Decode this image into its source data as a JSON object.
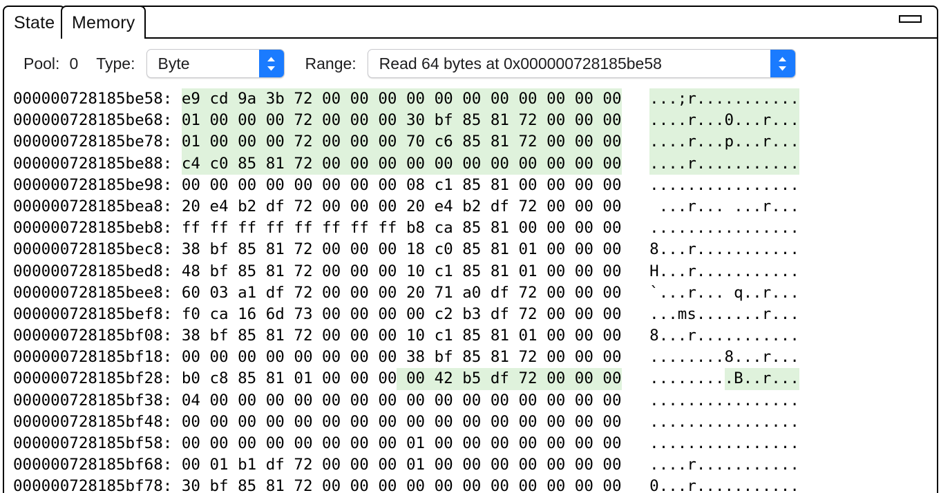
{
  "window": {
    "minimize_icon": "minimize-icon"
  },
  "tabs": [
    {
      "id": "state",
      "label": "State",
      "active": false
    },
    {
      "id": "memory",
      "label": "Memory",
      "active": true
    }
  ],
  "toolbar": {
    "pool_label": "Pool:",
    "pool_value": "0",
    "type_label": "Type:",
    "type_value": "Byte",
    "range_label": "Range:",
    "range_value": "Read 64 bytes at 0x000000728185be58",
    "stepper_icon": "stepper-up-down-icon",
    "accent_color": "#1a7bff"
  },
  "highlight_color": "#dff2dc",
  "hexdump": {
    "bytes_per_row": 16,
    "rows": [
      {
        "address": "000000728185be58",
        "bytes": [
          "e9",
          "cd",
          "9a",
          "3b",
          "72",
          "00",
          "00",
          "00",
          "00",
          "00",
          "00",
          "00",
          "00",
          "00",
          "00",
          "00"
        ],
        "ascii": "...;r...........",
        "hl_bytes": [
          0,
          15
        ],
        "hl_ascii": [
          0,
          15
        ]
      },
      {
        "address": "000000728185be68",
        "bytes": [
          "01",
          "00",
          "00",
          "00",
          "72",
          "00",
          "00",
          "00",
          "30",
          "bf",
          "85",
          "81",
          "72",
          "00",
          "00",
          "00"
        ],
        "ascii": "....r...0...r...",
        "hl_bytes": [
          0,
          15
        ],
        "hl_ascii": [
          0,
          15
        ]
      },
      {
        "address": "000000728185be78",
        "bytes": [
          "01",
          "00",
          "00",
          "00",
          "72",
          "00",
          "00",
          "00",
          "70",
          "c6",
          "85",
          "81",
          "72",
          "00",
          "00",
          "00"
        ],
        "ascii": "....r...p...r...",
        "hl_bytes": [
          0,
          15
        ],
        "hl_ascii": [
          0,
          15
        ]
      },
      {
        "address": "000000728185be88",
        "bytes": [
          "c4",
          "c0",
          "85",
          "81",
          "72",
          "00",
          "00",
          "00",
          "00",
          "00",
          "00",
          "00",
          "00",
          "00",
          "00",
          "00"
        ],
        "ascii": "....r...........",
        "hl_bytes": [
          0,
          15
        ],
        "hl_ascii": [
          0,
          15
        ]
      },
      {
        "address": "000000728185be98",
        "bytes": [
          "00",
          "00",
          "00",
          "00",
          "00",
          "00",
          "00",
          "00",
          "08",
          "c1",
          "85",
          "81",
          "00",
          "00",
          "00",
          "00"
        ],
        "ascii": "................",
        "hl_bytes": null,
        "hl_ascii": null
      },
      {
        "address": "000000728185bea8",
        "bytes": [
          "20",
          "e4",
          "b2",
          "df",
          "72",
          "00",
          "00",
          "00",
          "20",
          "e4",
          "b2",
          "df",
          "72",
          "00",
          "00",
          "00"
        ],
        "ascii": " ...r... ...r...",
        "hl_bytes": null,
        "hl_ascii": null
      },
      {
        "address": "000000728185beb8",
        "bytes": [
          "ff",
          "ff",
          "ff",
          "ff",
          "ff",
          "ff",
          "ff",
          "ff",
          "b8",
          "ca",
          "85",
          "81",
          "00",
          "00",
          "00",
          "00"
        ],
        "ascii": "................",
        "hl_bytes": null,
        "hl_ascii": null
      },
      {
        "address": "000000728185bec8",
        "bytes": [
          "38",
          "bf",
          "85",
          "81",
          "72",
          "00",
          "00",
          "00",
          "18",
          "c0",
          "85",
          "81",
          "01",
          "00",
          "00",
          "00"
        ],
        "ascii": "8...r...........",
        "hl_bytes": null,
        "hl_ascii": null
      },
      {
        "address": "000000728185bed8",
        "bytes": [
          "48",
          "bf",
          "85",
          "81",
          "72",
          "00",
          "00",
          "00",
          "10",
          "c1",
          "85",
          "81",
          "01",
          "00",
          "00",
          "00"
        ],
        "ascii": "H...r...........",
        "hl_bytes": null,
        "hl_ascii": null
      },
      {
        "address": "000000728185bee8",
        "bytes": [
          "60",
          "03",
          "a1",
          "df",
          "72",
          "00",
          "00",
          "00",
          "20",
          "71",
          "a0",
          "df",
          "72",
          "00",
          "00",
          "00"
        ],
        "ascii": "`...r... q..r...",
        "hl_bytes": null,
        "hl_ascii": null
      },
      {
        "address": "000000728185bef8",
        "bytes": [
          "f0",
          "ca",
          "16",
          "6d",
          "73",
          "00",
          "00",
          "00",
          "00",
          "c2",
          "b3",
          "df",
          "72",
          "00",
          "00",
          "00"
        ],
        "ascii": "...ms.......r...",
        "hl_bytes": null,
        "hl_ascii": null
      },
      {
        "address": "000000728185bf08",
        "bytes": [
          "38",
          "bf",
          "85",
          "81",
          "72",
          "00",
          "00",
          "00",
          "10",
          "c1",
          "85",
          "81",
          "01",
          "00",
          "00",
          "00"
        ],
        "ascii": "8...r...........",
        "hl_bytes": null,
        "hl_ascii": null
      },
      {
        "address": "000000728185bf18",
        "bytes": [
          "00",
          "00",
          "00",
          "00",
          "00",
          "00",
          "00",
          "00",
          "38",
          "bf",
          "85",
          "81",
          "72",
          "00",
          "00",
          "00"
        ],
        "ascii": "........8...r...",
        "hl_bytes": null,
        "hl_ascii": null
      },
      {
        "address": "000000728185bf28",
        "bytes": [
          "b0",
          "c8",
          "85",
          "81",
          "01",
          "00",
          "00",
          "00",
          "00",
          "42",
          "b5",
          "df",
          "72",
          "00",
          "00",
          "00"
        ],
        "ascii": ".........B..r...",
        "hl_bytes": [
          8,
          15
        ],
        "hl_ascii": [
          8,
          15
        ]
      },
      {
        "address": "000000728185bf38",
        "bytes": [
          "04",
          "00",
          "00",
          "00",
          "00",
          "00",
          "00",
          "00",
          "00",
          "00",
          "00",
          "00",
          "00",
          "00",
          "00",
          "00"
        ],
        "ascii": "................",
        "hl_bytes": null,
        "hl_ascii": null
      },
      {
        "address": "000000728185bf48",
        "bytes": [
          "00",
          "00",
          "00",
          "00",
          "00",
          "00",
          "00",
          "00",
          "00",
          "00",
          "00",
          "00",
          "00",
          "00",
          "00",
          "00"
        ],
        "ascii": "................",
        "hl_bytes": null,
        "hl_ascii": null
      },
      {
        "address": "000000728185bf58",
        "bytes": [
          "00",
          "00",
          "00",
          "00",
          "00",
          "00",
          "00",
          "00",
          "01",
          "00",
          "00",
          "00",
          "00",
          "00",
          "00",
          "00"
        ],
        "ascii": "................",
        "hl_bytes": null,
        "hl_ascii": null
      },
      {
        "address": "000000728185bf68",
        "bytes": [
          "00",
          "01",
          "b1",
          "df",
          "72",
          "00",
          "00",
          "00",
          "01",
          "00",
          "00",
          "00",
          "00",
          "00",
          "00",
          "00"
        ],
        "ascii": "....r...........",
        "hl_bytes": null,
        "hl_ascii": null
      },
      {
        "address": "000000728185bf78",
        "bytes": [
          "30",
          "bf",
          "85",
          "81",
          "72",
          "00",
          "00",
          "00",
          "00",
          "00",
          "00",
          "00",
          "00",
          "00",
          "00",
          "00"
        ],
        "ascii": "0...r...........",
        "hl_bytes": null,
        "hl_ascii": null
      }
    ]
  }
}
